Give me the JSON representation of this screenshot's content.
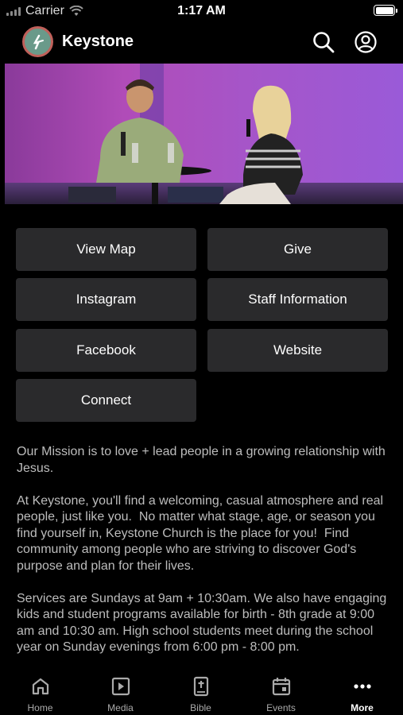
{
  "status_bar": {
    "carrier": "Carrier",
    "time": "1:17 AM"
  },
  "header": {
    "title": "Keystone"
  },
  "buttons": [
    "View Map",
    "Give",
    "Instagram",
    "Staff Information",
    "Facebook",
    "Website",
    "Connect"
  ],
  "body": {
    "paragraphs": [
      "Our Mission is to love + lead people in a growing relationship with Jesus.",
      "At Keystone, you'll find a welcoming, casual atmosphere and real people, just like you.  No matter what stage, age, or season you find yourself in, Keystone Church is the place for you!  Find community among people who are striving to discover God's purpose and plan for their lives.",
      "Services are Sundays at 9am + 10:30am. We also have engaging kids and student programs available for birth - 8th grade at 9:00 am and 10:30 am. High school students meet during the school year on Sunday evenings from 6:00 pm - 8:00 pm."
    ]
  },
  "tab_bar": {
    "items": [
      {
        "label": "Home",
        "icon": "home-icon"
      },
      {
        "label": "Media",
        "icon": "media-icon"
      },
      {
        "label": "Bible",
        "icon": "bible-icon"
      },
      {
        "label": "Events",
        "icon": "events-icon"
      },
      {
        "label": "More",
        "icon": "more-icon"
      }
    ],
    "active": "More"
  }
}
